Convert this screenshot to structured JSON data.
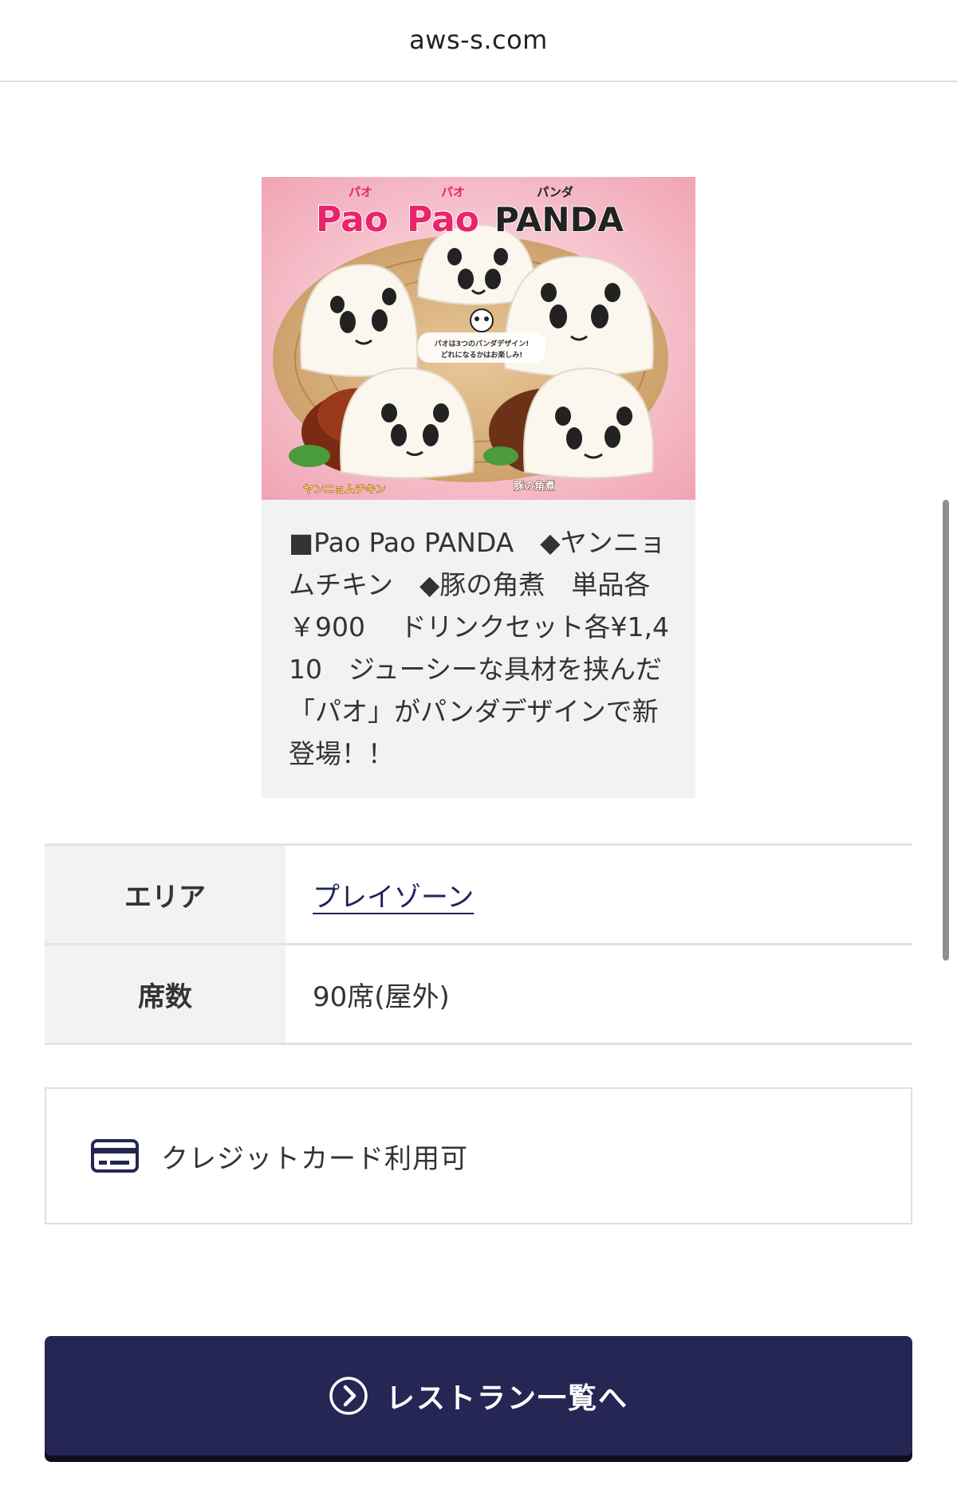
{
  "browser": {
    "url": "aws-s.com"
  },
  "card": {
    "image": {
      "title_ruby": [
        "パオ",
        "パオ",
        "パンダ"
      ],
      "title_parts": [
        "Pao",
        "Pao",
        "PANDA"
      ],
      "callout_line1": "パオは3つのパンダデザイン!",
      "callout_line2": "どれになるかはお楽しみ!",
      "label_left": "ヤンニョムチキン",
      "label_right": "豚の角煮"
    },
    "description": "■Pao Pao PANDA　◆ヤンニョムチキン　◆豚の角煮　単品各￥900　 ドリンクセット各¥1,410　ジューシーな具材を挟んだ「パオ」がパンダデザインで新登場！！"
  },
  "info_table": {
    "area_label": "エリア",
    "area_value": "プレイゾーン",
    "seats_label": "席数",
    "seats_value": "90席(屋外)"
  },
  "payment": {
    "credit_card_label": "クレジットカード利用可",
    "icon": "credit-card-icon"
  },
  "back_button": {
    "label": "レストラン一覧へ",
    "icon": "chevron-circle-right-icon"
  },
  "colors": {
    "brand_navy": "#252654",
    "link_navy": "#1e2458",
    "title_pink": "#e8246c",
    "image_bg_pink": "#f4b9c4"
  }
}
